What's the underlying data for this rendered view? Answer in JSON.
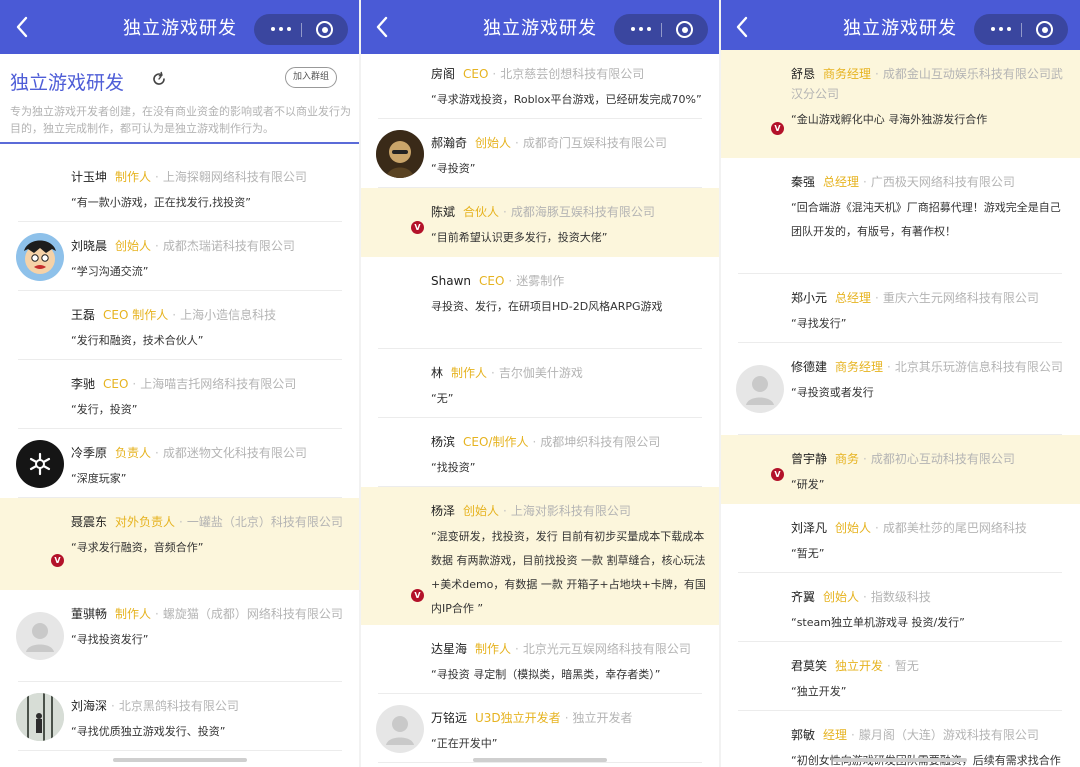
{
  "nav_title": "独立游戏研发",
  "group": {
    "title": "独立游戏研发",
    "join_label": "加入群组",
    "description": "专为独立游戏开发者创建，在没有商业资金的影响或者不以商业发行为目的，独立完成制作，都可认为是独立游戏制作行为。"
  },
  "badge_label": "V",
  "icons": {
    "back": "back-chevron-icon",
    "more": "more-dots-icon",
    "close": "target-icon",
    "refresh": "refresh-icon",
    "verified": "verified-badge-icon"
  },
  "colors": {
    "nav": "#4a5ad6",
    "capsule": "#3a469f",
    "role": "#e6b320",
    "highlight": "#fcf6dc",
    "badge": "#b3122a"
  },
  "panels": [
    {
      "members": [
        {
          "name": "计玉坤",
          "role": "制作人",
          "company": "上海探翱网络科技有限公司",
          "quote": "“有一款小游戏，正在找发行,找投资”",
          "avatar": "",
          "verified": false,
          "highlight": false
        },
        {
          "name": "刘晓晨",
          "role": "创始人",
          "company": "成都杰瑞诺科技有限公司",
          "quote": "“学习沟通交流”",
          "avatar": "cartoon",
          "verified": false,
          "highlight": false
        },
        {
          "name": "王磊",
          "role": "CEO 制作人",
          "company": "上海小造信息科技",
          "quote": "“发行和融资，技术合伙人”",
          "avatar": "",
          "verified": false,
          "highlight": false
        },
        {
          "name": "李驰",
          "role": "CEO",
          "company": "上海喵吉托网络科技有限公司",
          "quote": "“发行，投资”",
          "avatar": "",
          "verified": false,
          "highlight": false
        },
        {
          "name": "冷季原",
          "role": "负责人",
          "company": "成都迷物文化科技有限公司",
          "quote": "“深度玩家”",
          "avatar": "dark",
          "verified": false,
          "highlight": false
        },
        {
          "name": "聂震东",
          "role": "对外负责人",
          "company": "一罐盐（北京）科技有限公司",
          "quote": "“寻求发行融资，音频合作”",
          "avatar": "",
          "verified": true,
          "highlight": true
        },
        {
          "name": "董骐畅",
          "role": "制作人",
          "company": "螺旋猫（成都）网络科技有限公司",
          "quote": "“寻找投资发行”",
          "avatar": "default",
          "verified": false,
          "highlight": false
        },
        {
          "name": "刘海深",
          "role": "",
          "company": "北京黑鸽科技有限公司",
          "quote": "“寻找优质独立游戏发行、投资”",
          "avatar": "forest",
          "verified": false,
          "highlight": false
        }
      ]
    },
    {
      "members": [
        {
          "name": "房阁",
          "role": "CEO",
          "company": "北京慈芸创想科技有限公司",
          "quote": "“寻求游戏投资，Roblox平台游戏，已经研发完成70%”",
          "avatar": "",
          "verified": false,
          "highlight": false
        },
        {
          "name": "郝瀚奇",
          "role": "创始人",
          "company": "成都奇门互娱科技有限公司",
          "quote": "“寻投资”",
          "avatar": "photo",
          "verified": false,
          "highlight": false
        },
        {
          "name": "陈斌",
          "role": "合伙人",
          "company": "成都海豚互娱科技有限公司",
          "quote": "“目前希望认识更多发行，投资大佬”",
          "avatar": "",
          "verified": true,
          "highlight": true
        },
        {
          "name": "Shawn",
          "role": "CEO",
          "company": "迷雾制作",
          "quote": " 寻投资、发行，在研项目HD-2D风格ARPG游戏",
          "avatar": "",
          "verified": false,
          "highlight": false
        },
        {
          "name": "林",
          "role": "制作人",
          "company": "吉尔伽美什游戏",
          "quote": "“无”",
          "avatar": "",
          "verified": false,
          "highlight": false
        },
        {
          "name": "杨滨",
          "role": "CEO/制作人",
          "company": "成都坤织科技有限公司",
          "quote": "“找投资”",
          "avatar": "",
          "verified": false,
          "highlight": false
        },
        {
          "name": "杨泽",
          "role": "创始人",
          "company": "上海对影科技有限公司",
          "quote": "“混变研发，找投资，发行 目前有初步买量成本下载成本数据 有两款游戏，目前找投资 一款 割草缝合，核心玩法+美术demo，有数据 一款 开箱子+占地块+卡牌，有国内IP合作 ”",
          "avatar": "",
          "verified": true,
          "highlight": true
        },
        {
          "name": "达星海",
          "role": "制作人",
          "company": "北京光元互娱网络科技有限公司",
          "quote": "“寻投资 寻定制（模拟类，暗黑类，幸存者类）”",
          "avatar": "",
          "verified": false,
          "highlight": false
        },
        {
          "name": "万铭远",
          "role": "U3D独立开发者",
          "company": "独立开发者",
          "quote": "“正在开发中”",
          "avatar": "default",
          "verified": false,
          "highlight": false
        }
      ]
    },
    {
      "members": [
        {
          "name": "舒恳",
          "role": "商务经理",
          "company": "成都金山互动娱乐科技有限公司武汉分公司",
          "quote": "“金山游戏孵化中心 寻海外独游发行合作",
          "avatar": "",
          "verified": true,
          "highlight": true
        },
        {
          "name": "秦强",
          "role": "总经理",
          "company": "广西极天网络科技有限公司",
          "quote": "“回合端游《混沌天机》厂商招募代理！游戏完全是自己团队开发的，有版号，有著作权！",
          "avatar": "",
          "verified": false,
          "highlight": false
        },
        {
          "name": "郑小元",
          "role": "总经理",
          "company": "重庆六生元网络科技有限公司",
          "quote": "“寻找发行”",
          "avatar": "",
          "verified": false,
          "highlight": false
        },
        {
          "name": "修德建",
          "role": "商务经理",
          "company": "北京其乐玩游信息科技有限公司",
          "quote": "“寻投资或者发行",
          "avatar": "default",
          "verified": false,
          "highlight": false
        },
        {
          "name": "曾宇静",
          "role": "商务",
          "company": "成都初心互动科技有限公司",
          "quote": "“研发”",
          "avatar": "",
          "verified": true,
          "highlight": true
        },
        {
          "name": "刘泽凡",
          "role": "创始人",
          "company": "成都美杜莎的尾巴网络科技",
          "quote": "“暂无”",
          "avatar": "",
          "verified": false,
          "highlight": false
        },
        {
          "name": "齐翼",
          "role": "创始人",
          "company": "指数级科技",
          "quote": "“steam独立单机游戏寻 投资/发行”",
          "avatar": "",
          "verified": false,
          "highlight": false
        },
        {
          "name": "君莫笑",
          "role": "独立开发",
          "company": "暂无",
          "quote": "“独立开发”",
          "avatar": "",
          "verified": false,
          "highlight": false
        },
        {
          "name": "郭敏",
          "role": "经理",
          "company": "朦月阁（大连）游戏科技有限公司",
          "quote": "“初创女性向游戏研发团队需要融资，后续有需求找合作",
          "avatar": "",
          "verified": false,
          "highlight": false
        }
      ]
    }
  ]
}
